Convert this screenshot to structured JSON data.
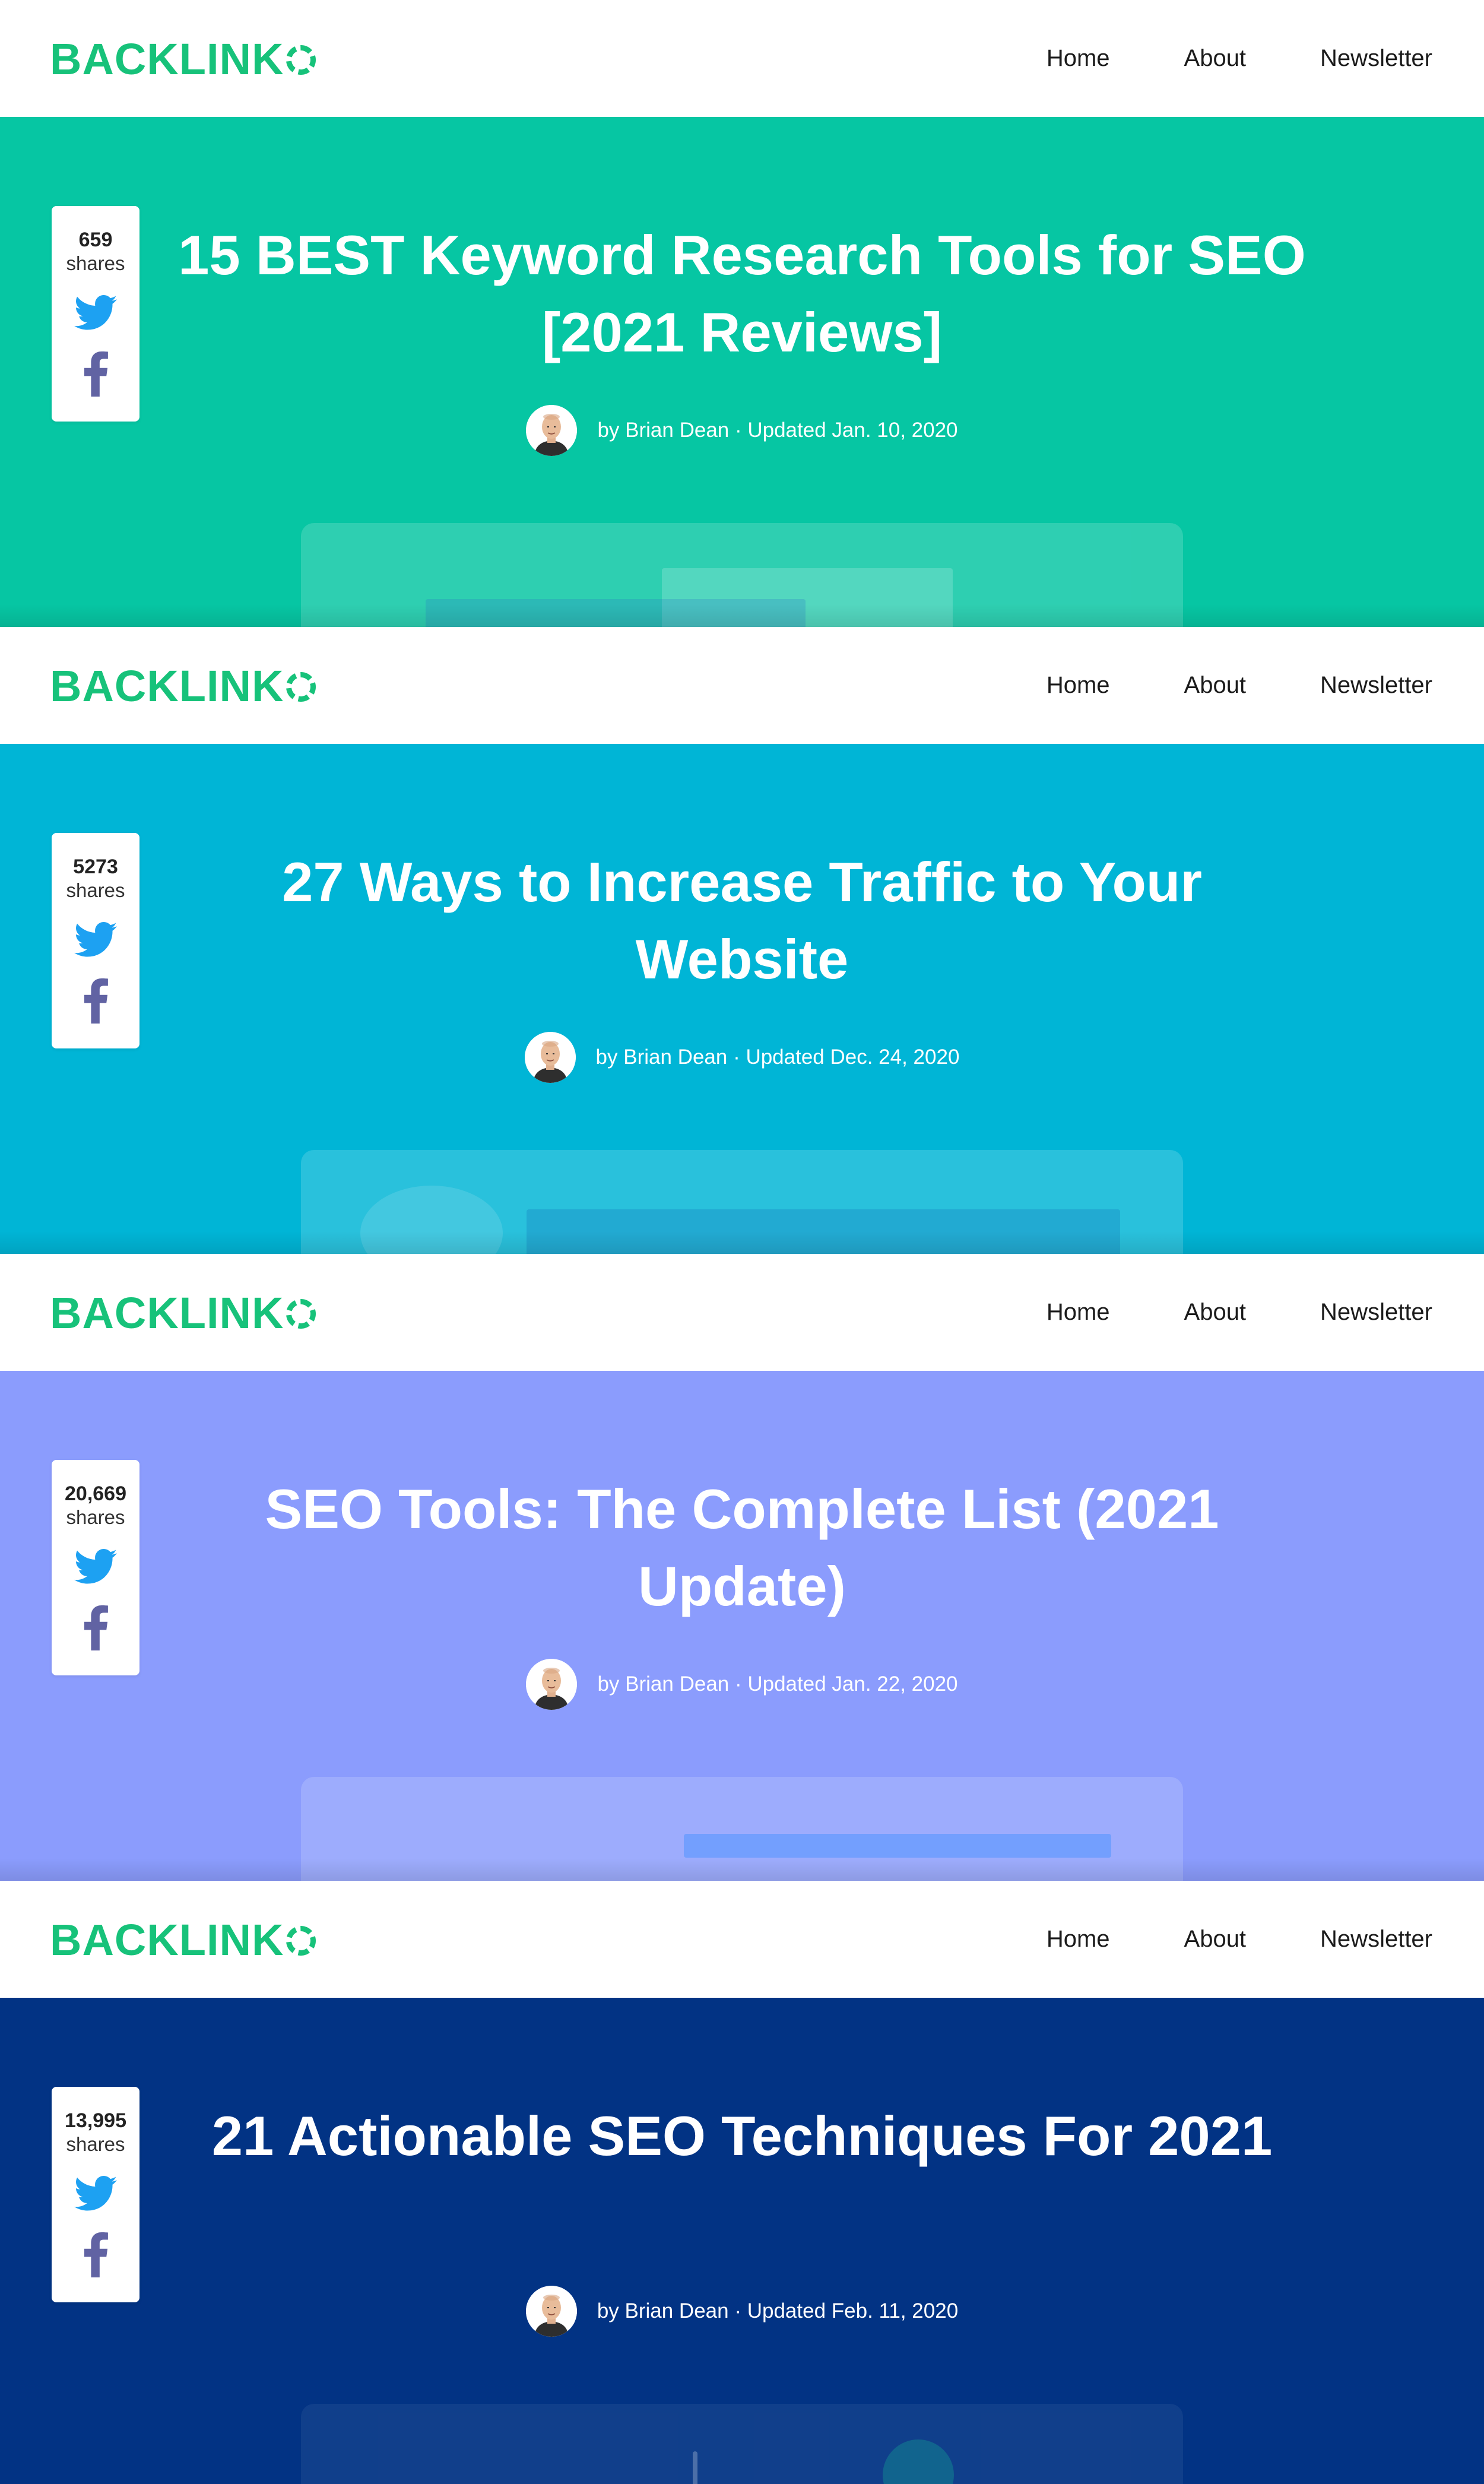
{
  "header": {
    "logo_text": "BACKLINK",
    "nav": [
      {
        "label": "Home"
      },
      {
        "label": "About"
      },
      {
        "label": "Newsletter"
      }
    ]
  },
  "posts": [
    {
      "title": "15 BEST Keyword Research Tools for SEO [2021 Reviews]",
      "byline": "by Brian Dean · Updated Jan. 10, 2020",
      "share_count": "659",
      "share_label": "shares",
      "background": "#06c6a3"
    },
    {
      "title": "27 Ways to Increase Traffic to Your Website",
      "byline": "by Brian Dean · Updated Dec. 24, 2020",
      "share_count": "5273",
      "share_label": "shares",
      "background": "#00b5d6"
    },
    {
      "title": "SEO Tools: The Complete List (2021 Update)",
      "byline": "by Brian Dean · Updated Jan. 22, 2020",
      "share_count": "20,669",
      "share_label": "shares",
      "background": "#8b9cfd"
    },
    {
      "title": "21 Actionable SEO Techniques For 2021",
      "byline": "by Brian Dean · Updated Feb. 11, 2020",
      "share_count": "13,995",
      "share_label": "shares",
      "background": "#023384"
    }
  ],
  "colors": {
    "brand": "#17c27a",
    "twitter": "#1da1f2",
    "facebook": "#6163a3"
  },
  "icons": {
    "twitter": "twitter-icon",
    "facebook": "facebook-icon"
  }
}
